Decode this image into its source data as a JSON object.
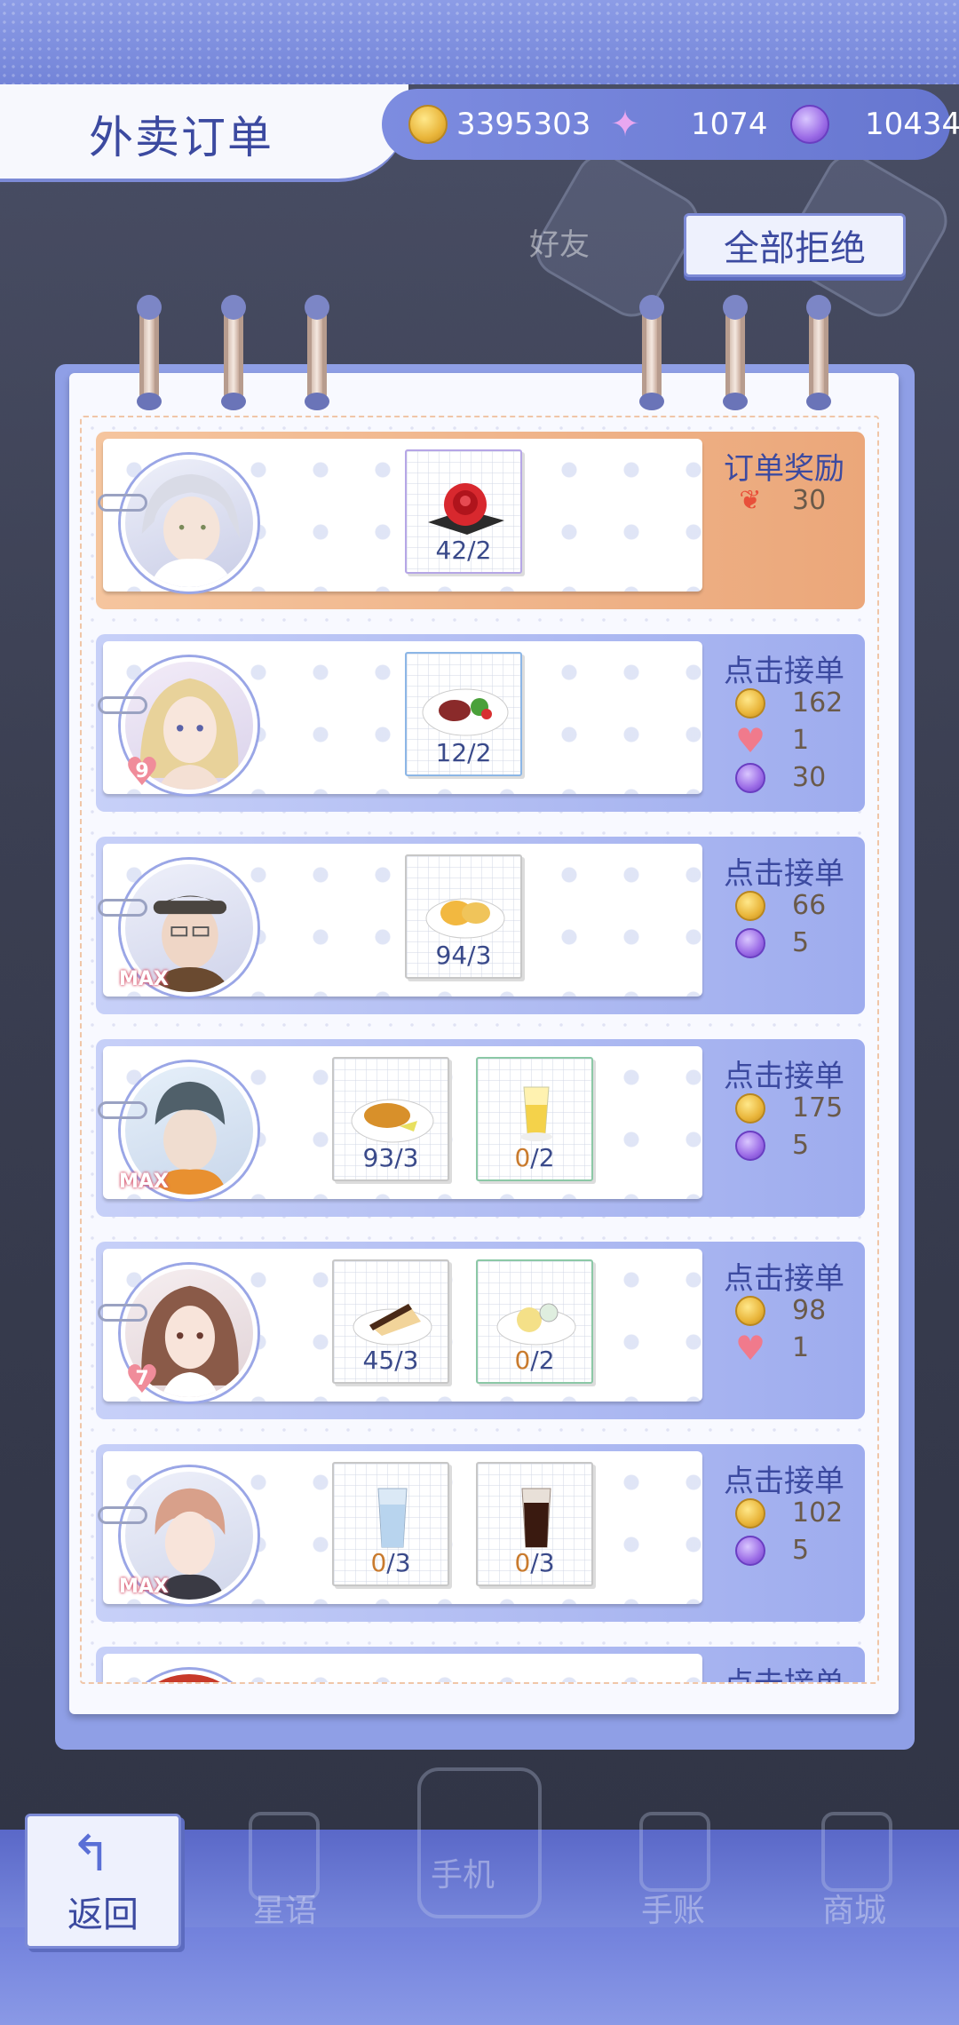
{
  "header": {
    "title": "外卖订单",
    "coins": "3395303",
    "swan_tickets": "1074",
    "gems": "10434"
  },
  "actions": {
    "reject_all": "全部拒绝"
  },
  "background_labels": {
    "friends": "好友"
  },
  "orders": [
    {
      "status": "订单奖励",
      "items": [
        {
          "qty": "42/2",
          "have": "42",
          "need": "2"
        }
      ],
      "rewards": [
        {
          "icon": "fish-icon",
          "value": "30"
        }
      ]
    },
    {
      "status": "点击接单",
      "badge": "9",
      "items": [
        {
          "qty": "12/2",
          "have": "12",
          "need": "2"
        }
      ],
      "rewards": [
        {
          "icon": "coin-icon",
          "value": "162"
        },
        {
          "icon": "heart-icon",
          "value": "1"
        },
        {
          "icon": "gem-icon",
          "value": "30"
        }
      ]
    },
    {
      "status": "点击接单",
      "badge": "MAX",
      "items": [
        {
          "qty": "94/3",
          "have": "94",
          "need": "3"
        }
      ],
      "rewards": [
        {
          "icon": "coin-icon",
          "value": "66"
        },
        {
          "icon": "gem-icon",
          "value": "5"
        }
      ]
    },
    {
      "status": "点击接单",
      "badge": "MAX",
      "items": [
        {
          "have": "93",
          "need": "3"
        },
        {
          "have": "0",
          "need": "2"
        }
      ],
      "rewards": [
        {
          "icon": "coin-icon",
          "value": "175"
        },
        {
          "icon": "gem-icon",
          "value": "5"
        }
      ]
    },
    {
      "status": "点击接单",
      "badge": "7",
      "items": [
        {
          "have": "45",
          "need": "3"
        },
        {
          "have": "0",
          "need": "2"
        }
      ],
      "rewards": [
        {
          "icon": "coin-icon",
          "value": "98"
        },
        {
          "icon": "heart-icon",
          "value": "1"
        }
      ]
    },
    {
      "status": "点击接单",
      "badge": "MAX",
      "items": [
        {
          "have": "0",
          "need": "3"
        },
        {
          "have": "0",
          "need": "3"
        }
      ],
      "rewards": [
        {
          "icon": "coin-icon",
          "value": "102"
        },
        {
          "icon": "gem-icon",
          "value": "5"
        }
      ]
    },
    {
      "status": "点击接单"
    }
  ],
  "bottom_nav": {
    "back": "返回",
    "star_words": "星语",
    "phone": "手机",
    "journal": "手账",
    "store": "商城"
  }
}
